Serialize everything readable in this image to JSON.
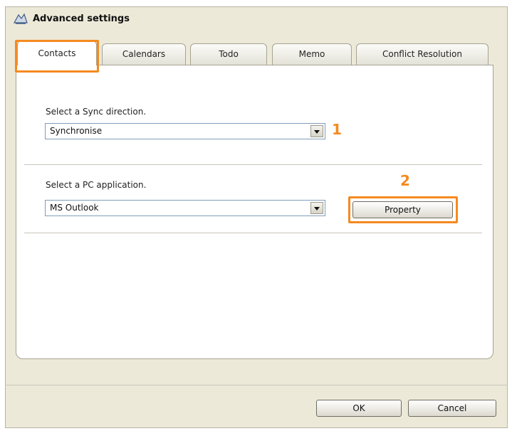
{
  "window": {
    "title": "Advanced settings"
  },
  "tabs": [
    "Contacts",
    "Calendars",
    "Todo",
    "Memo",
    "Conflict Resolution"
  ],
  "sync_section": {
    "label": "Select a Sync direction.",
    "selected": "Synchronise",
    "callout": "1"
  },
  "app_section": {
    "label": "Select a PC application.",
    "selected": "MS Outlook",
    "callout": "2",
    "property_label": "Property"
  },
  "footer": {
    "ok_label": "OK",
    "cancel_label": "Cancel"
  },
  "colors": {
    "highlight": "#f58a1f",
    "dialog_bg": "#ece9d8"
  }
}
